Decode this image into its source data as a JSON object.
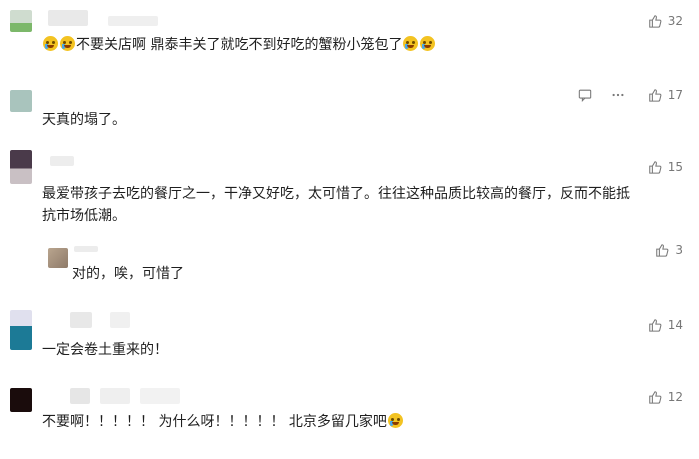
{
  "comments": [
    {
      "text_before": "",
      "text_mid": "不要关店啊 鼎泰丰关了就吃不到好吃的蟹粉小笼包了",
      "likes": "32",
      "emoji_front": 2,
      "emoji_end": 2
    },
    {
      "text": "天真的塌了。",
      "likes": "17"
    },
    {
      "text_l1": "最爱带孩子去吃的餐厅之一，干净又好吃，太可惜了。往往这种品质比较高的餐厅，反而不能抵",
      "text_l2": "抗市场低潮。",
      "likes": "15"
    },
    {
      "text": "对的，唉，可惜了",
      "likes": "3"
    },
    {
      "text": "一定会卷土重来的！",
      "likes": "14"
    },
    {
      "text": "不要啊！！！！！ 为什么呀！！！！！ 北京多留几家吧",
      "likes": "12"
    }
  ],
  "icons": {
    "like": "thumbs-up-icon",
    "reply": "reply-icon",
    "more": "more-icon",
    "emoji": "crying-face-icon"
  }
}
